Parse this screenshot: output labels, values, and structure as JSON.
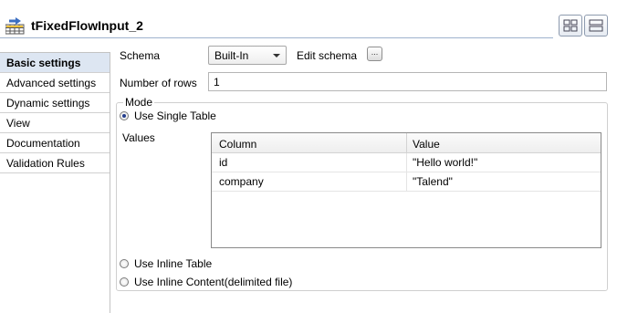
{
  "title": {
    "text": "tFixedFlowInput_2",
    "icon": "fixed-flow-input-component-icon"
  },
  "toolbar": {
    "grid_view_icon": "grid-layout-icon",
    "rows_view_icon": "rows-layout-icon"
  },
  "sidebar": {
    "items": [
      {
        "label": "Basic settings",
        "active": true
      },
      {
        "label": "Advanced settings",
        "active": false
      },
      {
        "label": "Dynamic settings",
        "active": false
      },
      {
        "label": "View",
        "active": false
      },
      {
        "label": "Documentation",
        "active": false
      },
      {
        "label": "Validation Rules",
        "active": false
      }
    ]
  },
  "schema": {
    "label": "Schema",
    "value": "Built-In",
    "edit_label": "Edit schema",
    "edit_button": "..."
  },
  "rows": {
    "label": "Number of rows",
    "value": "1"
  },
  "mode": {
    "legend": "Mode",
    "options": [
      {
        "label": "Use Single Table",
        "checked": true
      },
      {
        "label": "Use Inline Table",
        "checked": false
      },
      {
        "label": "Use Inline Content(delimited file)",
        "checked": false
      }
    ],
    "values_label": "Values"
  },
  "table": {
    "columns": [
      "Column",
      "Value"
    ],
    "rows": [
      {
        "column": "id",
        "value": "\"Hello world!\""
      },
      {
        "column": "company",
        "value": "\"Talend\""
      }
    ]
  },
  "colors": {
    "accent": "#233c8c",
    "active_sidebar": "#dde6f2"
  }
}
